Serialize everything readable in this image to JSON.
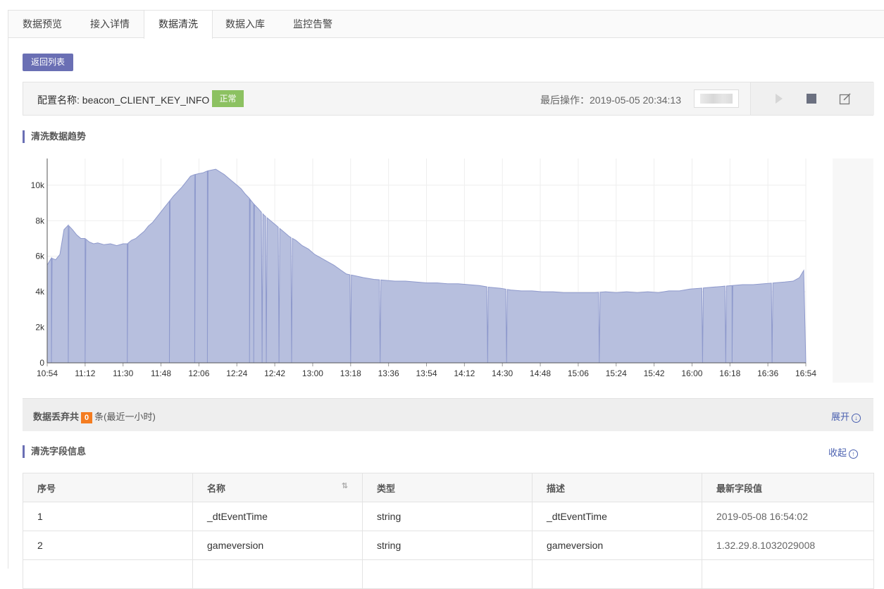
{
  "tabs": [
    {
      "label": "数据预览",
      "active": false
    },
    {
      "label": "接入详情",
      "active": false
    },
    {
      "label": "数据清洗",
      "active": true
    },
    {
      "label": "数据入库",
      "active": false
    },
    {
      "label": "监控告警",
      "active": false
    }
  ],
  "back_button": "返回列表",
  "config": {
    "name_label": "配置名称: beacon_CLIENT_KEY_INFO",
    "status": "正常",
    "last_op": "最后操作：2019-05-05 20:34:13",
    "actions": [
      "play-icon",
      "stop-icon",
      "edit-icon"
    ]
  },
  "trend_title": "清洗数据趋势",
  "colors": {
    "accent": "#6a6fb4",
    "area_fill": "#b3bcdc",
    "area_line": "#8e99cc",
    "status_ok": "#8cc161",
    "count_badge": "#f47c20",
    "link": "#4a60b0"
  },
  "chart_data": {
    "type": "area",
    "title": "",
    "xlabel": "",
    "ylabel": "",
    "ylim": [
      0,
      11500
    ],
    "yticks": [
      0,
      2000,
      4000,
      6000,
      8000,
      10000
    ],
    "ytick_labels": [
      "0",
      "2k",
      "4k",
      "6k",
      "8k",
      "10k"
    ],
    "x_tick_labels": [
      "10:54",
      "11:12",
      "11:30",
      "11:48",
      "12:06",
      "12:24",
      "12:42",
      "13:00",
      "13:18",
      "13:36",
      "13:54",
      "14:12",
      "14:30",
      "14:48",
      "15:06",
      "15:24",
      "15:42",
      "16:00",
      "16:18",
      "16:36",
      "16:54"
    ],
    "x_range_minutes": [
      0,
      360
    ],
    "grid": true,
    "series": [
      {
        "points": [
          [
            0,
            5500
          ],
          [
            2,
            5900
          ],
          [
            4,
            5800
          ],
          [
            6,
            6100
          ],
          [
            8,
            7500
          ],
          [
            10,
            7750
          ],
          [
            12,
            7500
          ],
          [
            14,
            7200
          ],
          [
            16,
            7000
          ],
          [
            18,
            7000
          ],
          [
            20,
            6800
          ],
          [
            22,
            6700
          ],
          [
            24,
            6750
          ],
          [
            27,
            6650
          ],
          [
            30,
            6700
          ],
          [
            33,
            6600
          ],
          [
            36,
            6700
          ],
          [
            38,
            6700
          ],
          [
            40,
            6900
          ],
          [
            42,
            7000
          ],
          [
            44,
            7200
          ],
          [
            46,
            7400
          ],
          [
            48,
            7700
          ],
          [
            50,
            7900
          ],
          [
            52,
            8200
          ],
          [
            54,
            8500
          ],
          [
            56,
            8800
          ],
          [
            58,
            9100
          ],
          [
            60,
            9400
          ],
          [
            62,
            9650
          ],
          [
            64,
            9900
          ],
          [
            66,
            10200
          ],
          [
            68,
            10500
          ],
          [
            70,
            10600
          ],
          [
            72,
            10650
          ],
          [
            74,
            10700
          ],
          [
            76,
            10800
          ],
          [
            78,
            10850
          ],
          [
            80,
            10900
          ],
          [
            82,
            10750
          ],
          [
            84,
            10600
          ],
          [
            86,
            10400
          ],
          [
            88,
            10200
          ],
          [
            90,
            10000
          ],
          [
            92,
            9800
          ],
          [
            94,
            9500
          ],
          [
            96,
            9250
          ],
          [
            98,
            8950
          ],
          [
            100,
            8700
          ],
          [
            103,
            8300
          ],
          [
            106,
            8000
          ],
          [
            109,
            7700
          ],
          [
            112,
            7400
          ],
          [
            115,
            7100
          ],
          [
            118,
            6900
          ],
          [
            121,
            6600
          ],
          [
            124,
            6400
          ],
          [
            127,
            6100
          ],
          [
            130,
            5900
          ],
          [
            133,
            5700
          ],
          [
            136,
            5500
          ],
          [
            139,
            5250
          ],
          [
            142,
            5000
          ],
          [
            146,
            4900
          ],
          [
            150,
            4800
          ],
          [
            155,
            4700
          ],
          [
            160,
            4650
          ],
          [
            165,
            4600
          ],
          [
            170,
            4600
          ],
          [
            175,
            4550
          ],
          [
            180,
            4500
          ],
          [
            185,
            4500
          ],
          [
            190,
            4450
          ],
          [
            195,
            4450
          ],
          [
            200,
            4400
          ],
          [
            205,
            4350
          ],
          [
            210,
            4250
          ],
          [
            215,
            4200
          ],
          [
            220,
            4100
          ],
          [
            225,
            4050
          ],
          [
            230,
            4050
          ],
          [
            235,
            4000
          ],
          [
            240,
            4000
          ],
          [
            245,
            3950
          ],
          [
            250,
            3950
          ],
          [
            255,
            3950
          ],
          [
            260,
            3950
          ],
          [
            265,
            4000
          ],
          [
            270,
            3950
          ],
          [
            275,
            4000
          ],
          [
            280,
            3950
          ],
          [
            285,
            4000
          ],
          [
            290,
            3950
          ],
          [
            295,
            4050
          ],
          [
            300,
            4050
          ],
          [
            305,
            4150
          ],
          [
            310,
            4200
          ],
          [
            315,
            4250
          ],
          [
            320,
            4300
          ],
          [
            325,
            4350
          ],
          [
            330,
            4400
          ],
          [
            335,
            4400
          ],
          [
            340,
            4450
          ],
          [
            345,
            4500
          ],
          [
            350,
            4550
          ],
          [
            354,
            4600
          ],
          [
            357,
            4800
          ],
          [
            359,
            5200
          ],
          [
            360,
            0
          ]
        ],
        "dips_at_minutes": [
          2,
          10,
          18,
          38,
          58,
          70,
          76,
          96,
          98,
          102,
          104,
          110,
          116,
          144,
          158,
          209,
          218,
          262,
          311,
          322,
          325,
          344
        ]
      }
    ]
  },
  "discard": {
    "prefix": "数据丢弃共",
    "count": "0",
    "suffix": "条(最近一小时)",
    "expand": "展开"
  },
  "fields_title": "清洗字段信息",
  "collapse": "收起",
  "table": {
    "headers": [
      "序号",
      "名称",
      "类型",
      "描述",
      "最新字段值"
    ],
    "rows": [
      [
        "1",
        "_dtEventTime",
        "string",
        "_dtEventTime",
        "2019-05-08 16:54:02"
      ],
      [
        "2",
        "gameversion",
        "string",
        "gameversion",
        "1.32.29.8.1032029008"
      ]
    ]
  }
}
